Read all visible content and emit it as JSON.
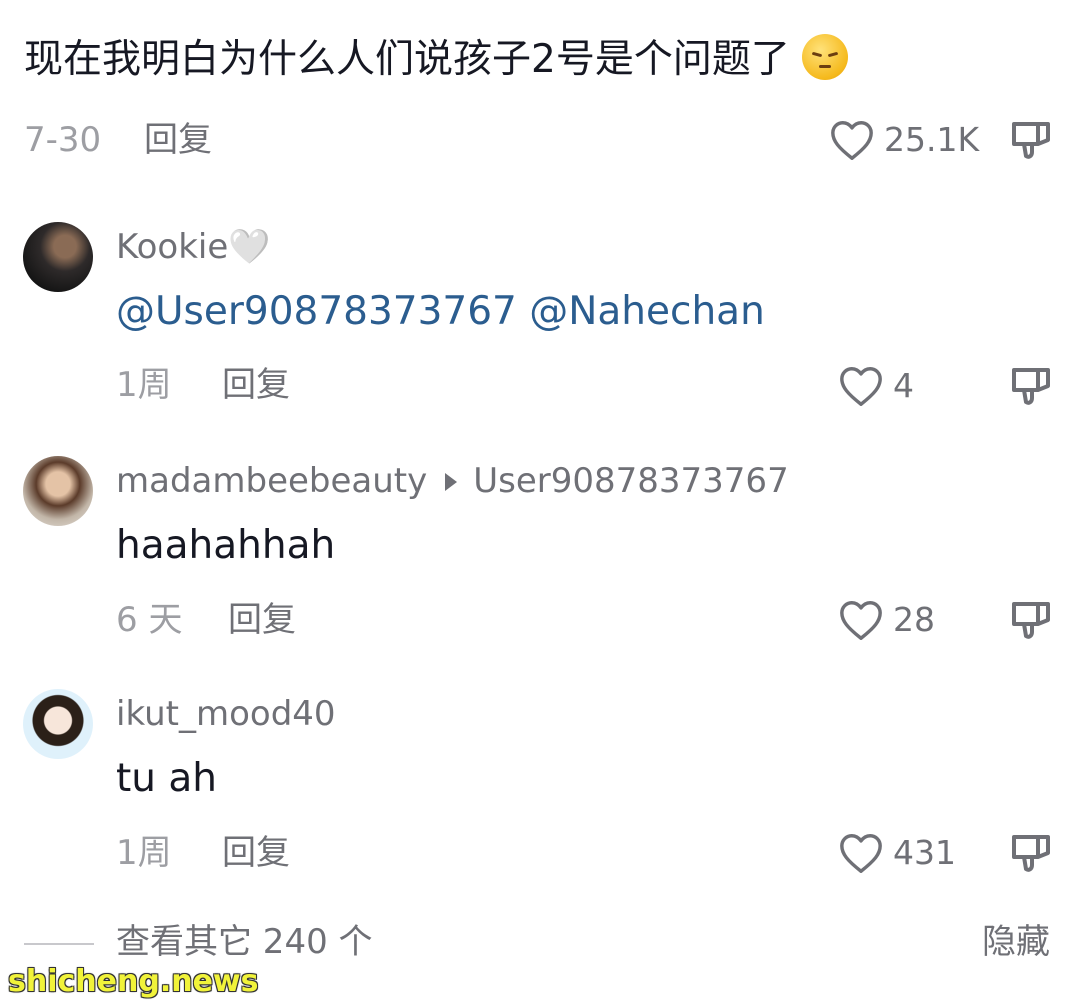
{
  "main_comment": {
    "text": "现在我明白为什么人们说孩子2号是个问题了",
    "emoji": "pensive-face",
    "date": "7-30",
    "reply_label": "回复",
    "likes": "25.1K"
  },
  "replies": [
    {
      "username": "Kookie",
      "username_emoji": "🤍",
      "mentions": "@User90878373767 @Nahechan",
      "date": "1周",
      "reply_label": "回复",
      "likes": "4"
    },
    {
      "username": "madambeebeauty",
      "reply_to": "User90878373767",
      "text": "haahahhah",
      "date": "6 天",
      "reply_label": "回复",
      "likes": "28"
    },
    {
      "username": "ikut_mood40",
      "text": "tu ah",
      "date": "1周",
      "reply_label": "回复",
      "likes": "431"
    }
  ],
  "footer": {
    "view_more": "查看其它 240 个",
    "hide": "隐藏"
  },
  "watermark": "shicheng.news",
  "colors": {
    "primary_text": "#161823",
    "secondary_text": "#6f7076",
    "date_text": "#9d9ea3",
    "mention": "#2b5d8f",
    "watermark": "#f1f33a"
  }
}
